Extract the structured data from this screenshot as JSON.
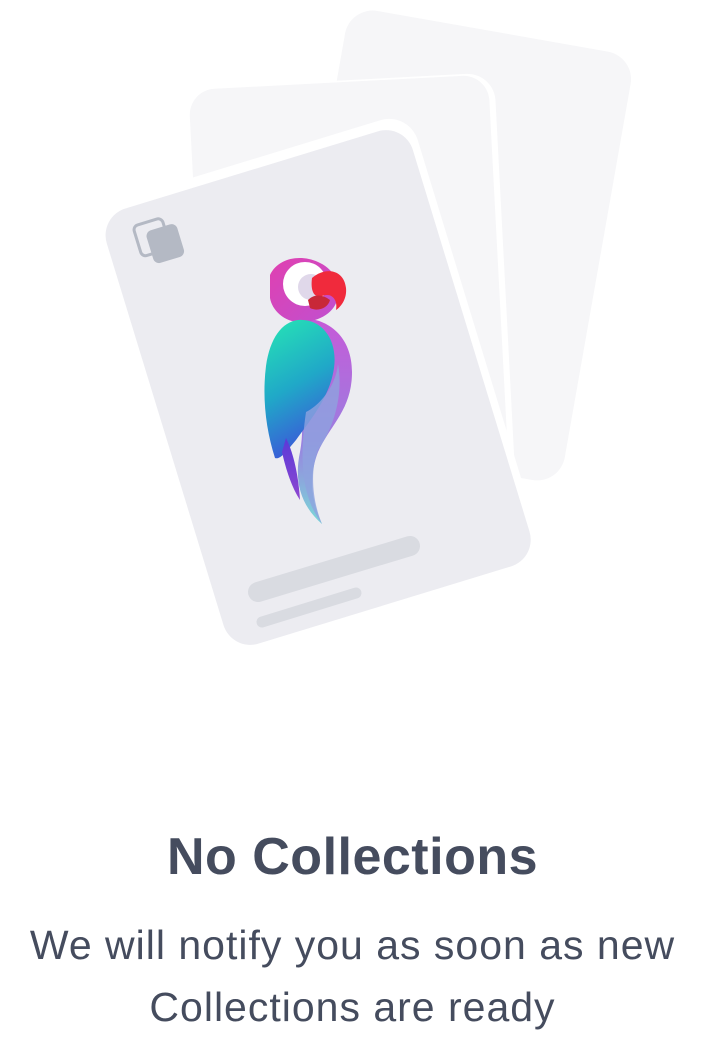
{
  "empty_state": {
    "title": "No Collections",
    "message_line1": "We will notify you as soon as new",
    "message_line2": "Collections are ready",
    "illustration": {
      "icons": [
        "collection-card-stack",
        "parrot-logo",
        "copy-icon"
      ]
    }
  },
  "colors": {
    "text": "#454c5e",
    "card_front": "#ececf1",
    "card_back": "#f6f6f8",
    "placeholder_bar": "#d9dbe1",
    "copy_icon": "#b4b9c4"
  }
}
